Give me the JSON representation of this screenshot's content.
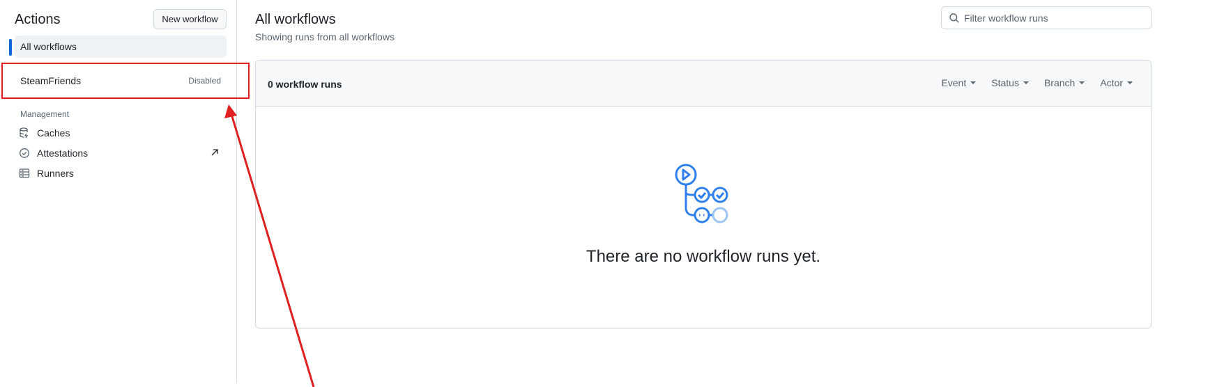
{
  "sidebar": {
    "title": "Actions",
    "new_workflow_label": "New workflow",
    "active_item": "All workflows",
    "workflows": [
      {
        "name": "SteamFriends",
        "badge": "Disabled"
      }
    ],
    "management_heading": "Management",
    "management_items": [
      {
        "label": "Caches",
        "icon": "database-icon"
      },
      {
        "label": "Attestations",
        "icon": "verified-check-icon",
        "external": true
      },
      {
        "label": "Runners",
        "icon": "server-icon"
      }
    ]
  },
  "main": {
    "title": "All workflows",
    "subtitle": "Showing runs from all workflows",
    "filter_placeholder": "Filter workflow runs",
    "runs_count": "0 workflow runs",
    "filters": [
      "Event",
      "Status",
      "Branch",
      "Actor"
    ],
    "empty_message": "There are no workflow runs yet."
  },
  "annotation": {
    "color": "#e02020"
  },
  "colors": {
    "accent": "#0969da",
    "illustration_blue": "#2f80ed",
    "illustration_light_blue": "#9cc4f5"
  }
}
